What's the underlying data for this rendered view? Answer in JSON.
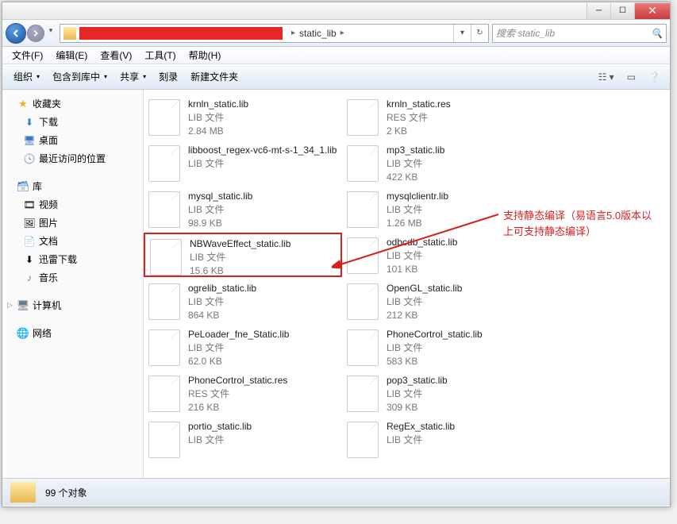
{
  "breadcrumb": {
    "label": "static_lib"
  },
  "search": {
    "placeholder": "搜索 static_lib"
  },
  "menu": {
    "file": "文件(F)",
    "edit": "编辑(E)",
    "view": "查看(V)",
    "tools": "工具(T)",
    "help": "帮助(H)"
  },
  "toolbar": {
    "organize": "组织",
    "include": "包含到库中",
    "share": "共享",
    "burn": "刻录",
    "newfolder": "新建文件夹"
  },
  "sidebar": {
    "favorites": {
      "label": "收藏夹",
      "items": [
        "下载",
        "桌面",
        "最近访问的位置"
      ]
    },
    "libraries": {
      "label": "库",
      "items": [
        "视频",
        "图片",
        "文档",
        "迅雷下载",
        "音乐"
      ]
    },
    "computer": {
      "label": "计算机"
    },
    "network": {
      "label": "网络"
    }
  },
  "files": {
    "col1": [
      {
        "name": "krnln_static.lib",
        "type": "LIB 文件",
        "size": "2.84 MB"
      },
      {
        "name": "libboost_regex-vc6-mt-s-1_34_1.lib",
        "type": "LIB 文件",
        "size": ""
      },
      {
        "name": "mysql_static.lib",
        "type": "LIB 文件",
        "size": "98.9 KB"
      },
      {
        "name": "NBWaveEffect_static.lib",
        "type": "LIB 文件",
        "size": "15.6 KB",
        "hl": true
      },
      {
        "name": "ogrelib_static.lib",
        "type": "LIB 文件",
        "size": "864 KB"
      },
      {
        "name": "PeLoader_fne_Static.lib",
        "type": "LIB 文件",
        "size": "62.0 KB"
      },
      {
        "name": "PhoneCortrol_static.res",
        "type": "RES 文件",
        "size": "216 KB"
      },
      {
        "name": "portio_static.lib",
        "type": "LIB 文件",
        "size": ""
      }
    ],
    "col2": [
      {
        "name": "krnln_static.res",
        "type": "RES 文件",
        "size": "2 KB"
      },
      {
        "name": "mp3_static.lib",
        "type": "LIB 文件",
        "size": "422 KB"
      },
      {
        "name": "mysqlclientr.lib",
        "type": "LIB 文件",
        "size": "1.26 MB"
      },
      {
        "name": "odbcdb_static.lib",
        "type": "LIB 文件",
        "size": "101 KB"
      },
      {
        "name": "OpenGL_static.lib",
        "type": "LIB 文件",
        "size": "212 KB"
      },
      {
        "name": "PhoneCortrol_static.lib",
        "type": "LIB 文件",
        "size": "583 KB"
      },
      {
        "name": "pop3_static.lib",
        "type": "LIB 文件",
        "size": "309 KB"
      },
      {
        "name": "RegEx_static.lib",
        "type": "LIB 文件",
        "size": ""
      }
    ]
  },
  "annotation": "支持静态编译（易语言5.0版本以上可支持静态编译）",
  "status": {
    "count": "99 个对象"
  }
}
